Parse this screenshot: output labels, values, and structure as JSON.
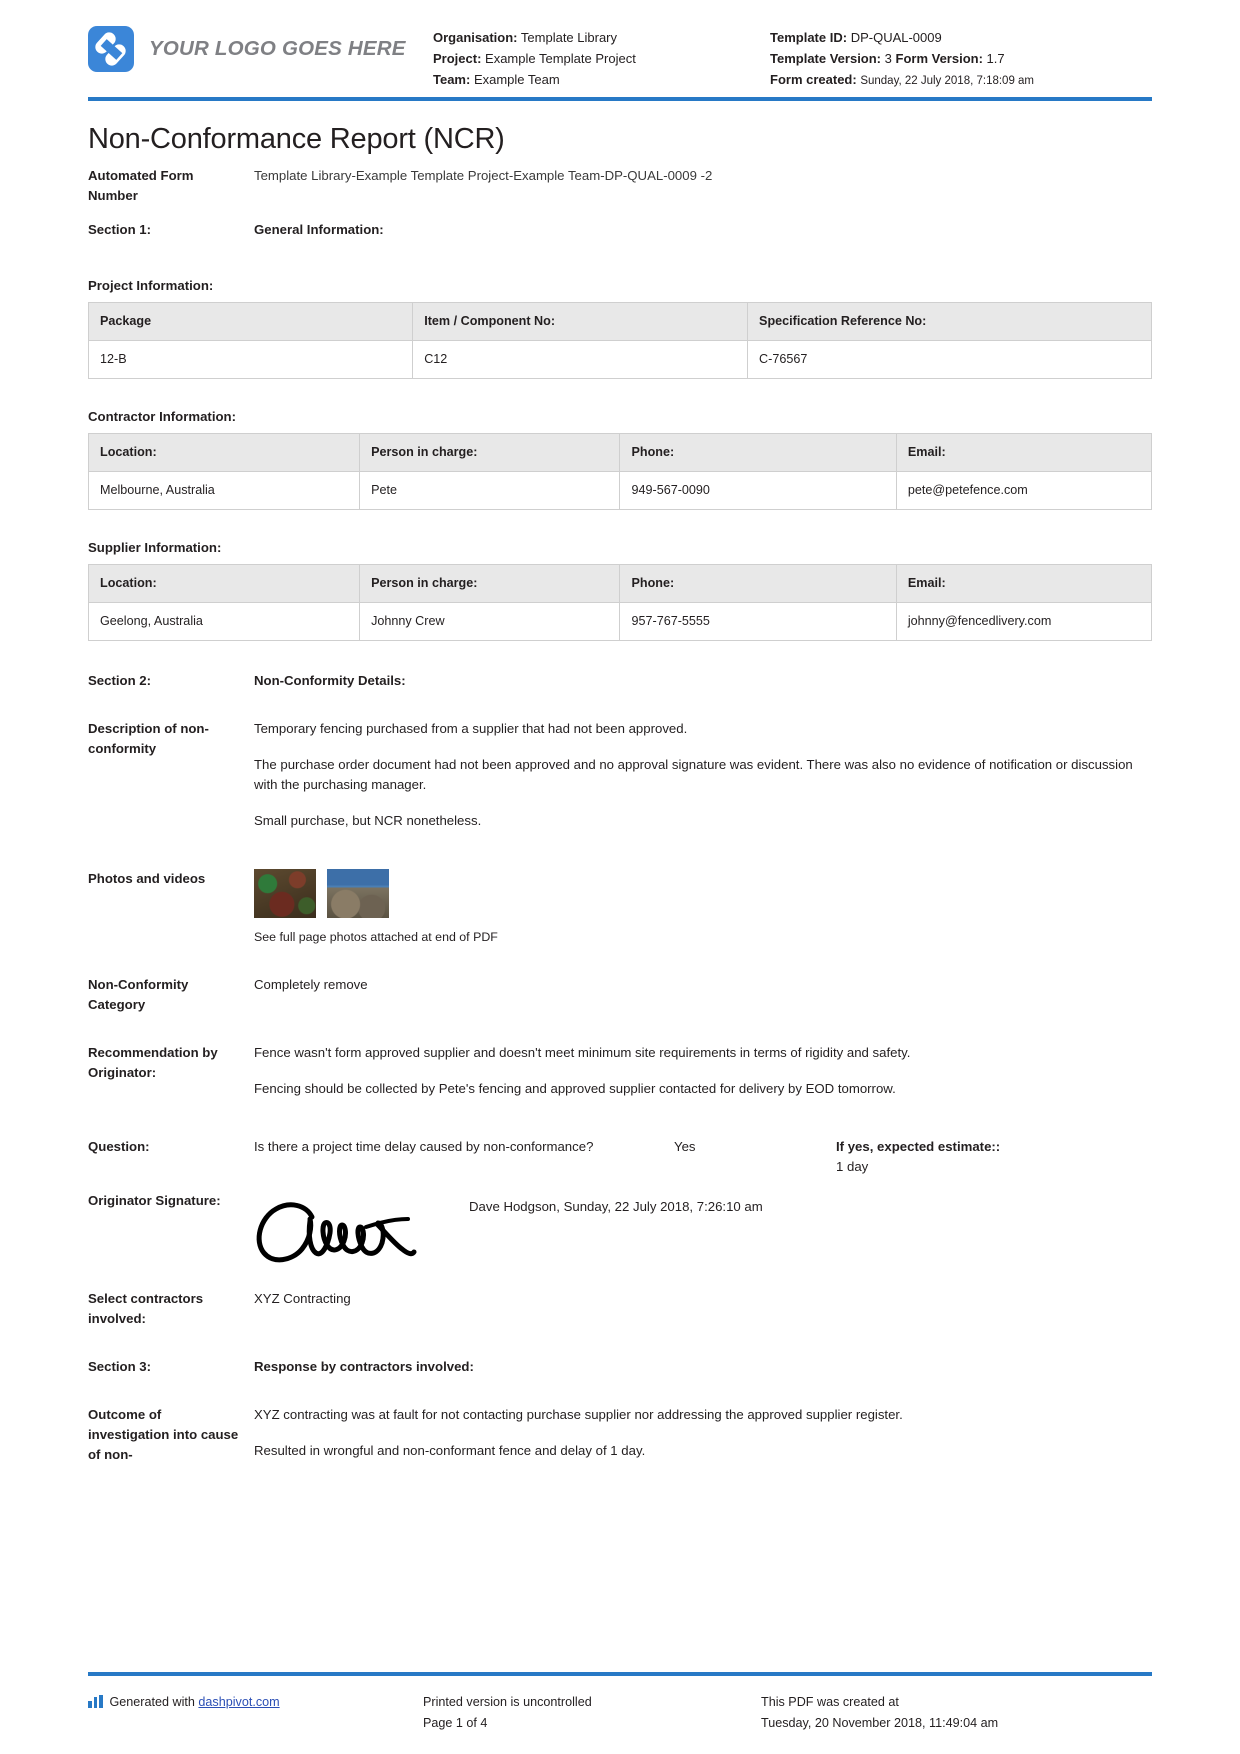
{
  "header": {
    "logo_text": "YOUR LOGO GOES HERE",
    "left": {
      "organisation_label": "Organisation:",
      "organisation_value": "Template Library",
      "project_label": "Project:",
      "project_value": "Example Template Project",
      "team_label": "Team:",
      "team_value": "Example Team"
    },
    "right": {
      "template_id_label": "Template ID:",
      "template_id_value": "DP-QUAL-0009",
      "template_version_label": "Template Version:",
      "template_version_value": "3",
      "form_version_label": "Form Version:",
      "form_version_value": "1.7",
      "form_created_label": "Form created:",
      "form_created_value": "Sunday, 22 July 2018, 7:18:09 am"
    },
    "accent_color": "#2779c6"
  },
  "document": {
    "title": "Non-Conformance Report (NCR)",
    "automated_form_number_label": "Automated Form Number",
    "automated_form_number_value": "Template Library-Example Template Project-Example Team-DP-QUAL-0009   -2",
    "section1_label": "Section 1:",
    "section1_title": "General Information:"
  },
  "project_information": {
    "heading": "Project Information:",
    "columns": [
      "Package",
      "Item / Component No:",
      "Specification Reference No:"
    ],
    "rows": [
      [
        "12-B",
        "C12",
        "C-76567"
      ]
    ]
  },
  "contractor_information": {
    "heading": "Contractor Information:",
    "columns": [
      "Location:",
      "Person in charge:",
      "Phone:",
      "Email:"
    ],
    "rows": [
      [
        "Melbourne, Australia",
        "Pete",
        "949-567-0090",
        "pete@petefence.com"
      ]
    ]
  },
  "supplier_information": {
    "heading": "Supplier Information:",
    "columns": [
      "Location:",
      "Person in charge:",
      "Phone:",
      "Email:"
    ],
    "rows": [
      [
        "Geelong, Australia",
        "Johnny Crew",
        "957-767-5555",
        "johnny@fencedlivery.com"
      ]
    ]
  },
  "section2": {
    "label": "Section 2:",
    "title": "Non-Conformity Details:",
    "description_label": "Description of non-conformity",
    "description_paragraphs": [
      "Temporary fencing purchased from a supplier that had not been approved.",
      "The purchase order document had not been approved and no approval signature was evident. There was also no evidence of notification or discussion with the purchasing manager.",
      "Small purchase, but NCR nonetheless."
    ],
    "photos_label": "Photos and videos",
    "photos_caption": "See full page photos attached at end of PDF",
    "category_label": "Non-Conformity Category",
    "category_value": "Completely remove",
    "recommendation_label": "Recommendation by Originator:",
    "recommendation_paragraphs": [
      "Fence wasn't form approved supplier and doesn't meet minimum site requirements in terms of rigidity and safety.",
      "Fencing should be collected by Pete's fencing and approved supplier contacted for delivery by EOD tomorrow."
    ],
    "question_label": "Question:",
    "question_text": "Is there a project time delay caused by non-conformance?",
    "question_answer": "Yes",
    "estimate_label": "If yes, expected estimate::",
    "estimate_value": "1 day",
    "signature_label": "Originator Signature:",
    "signature_name": "Dave Hodgson, Sunday, 22 July 2018, 7:26:10 am",
    "contractors_label": "Select contractors involved:",
    "contractors_value": "XYZ Contracting"
  },
  "section3": {
    "label": "Section 3:",
    "title": "Response by contractors involved:",
    "outcome_label": "Outcome of investigation into cause of non-",
    "outcome_paragraphs": [
      "XYZ contracting was at fault for not contacting purchase supplier nor addressing the approved supplier register.",
      "Resulted in wrongful and non-conformant fence and delay of 1 day."
    ]
  },
  "footer": {
    "generated_with": "Generated with",
    "generated_link": "dashpivot.com",
    "printed_notice": "Printed version is uncontrolled",
    "page_number": "Page 1 of 4",
    "created_notice": "This PDF was created at",
    "created_date": "Tuesday, 20 November 2018, 11:49:04 am"
  }
}
